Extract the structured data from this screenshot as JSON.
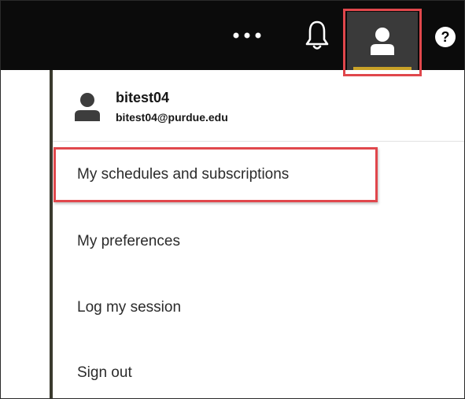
{
  "topbar": {
    "more_label": "•••",
    "help_label": "?",
    "accent_color": "#c9a227",
    "icons": [
      "more-icon",
      "bell-icon",
      "user-icon",
      "help-icon"
    ]
  },
  "profile": {
    "name": "bitest04",
    "email": "bitest04@purdue.edu"
  },
  "menu": {
    "items": [
      {
        "label": "My schedules and subscriptions"
      },
      {
        "label": "My preferences"
      },
      {
        "label": "Log my session"
      },
      {
        "label": "Sign out"
      }
    ]
  },
  "annotations": {
    "highlight_color": "#e0474c"
  }
}
